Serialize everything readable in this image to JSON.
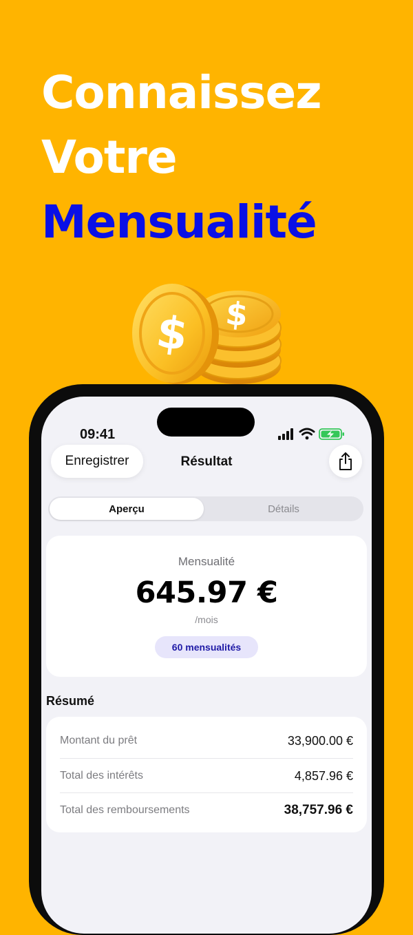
{
  "headline": {
    "line1": "Connaissez",
    "line2": "Votre",
    "line3": "Mensualité",
    "accent_color": "#0A10E6"
  },
  "decoration": {
    "coin_symbol": "$"
  },
  "status_bar": {
    "time": "09:41",
    "icons": [
      "signal-icon",
      "wifi-icon",
      "battery-charging-icon"
    ]
  },
  "nav": {
    "save_label": "Enregistrer",
    "title": "Résultat",
    "share_icon": "share-icon"
  },
  "tabs": [
    {
      "label": "Aperçu",
      "active": true
    },
    {
      "label": "Détails",
      "active": false
    }
  ],
  "payment": {
    "label": "Mensualité",
    "amount": "645.97 €",
    "unit": "/mois",
    "count_badge": "60 mensualités"
  },
  "summary": {
    "title": "Résumé",
    "rows": [
      {
        "label": "Montant du prêt",
        "value": "33,900.00 €"
      },
      {
        "label": "Total des intérêts",
        "value": "4,857.96 €"
      },
      {
        "label": "Total des remboursements",
        "value": "38,757.96 €"
      }
    ]
  },
  "colors": {
    "background": "#FFB400",
    "pill_bg": "#E7E5FB",
    "pill_text": "#1F1AA6",
    "battery_green": "#34C759"
  }
}
